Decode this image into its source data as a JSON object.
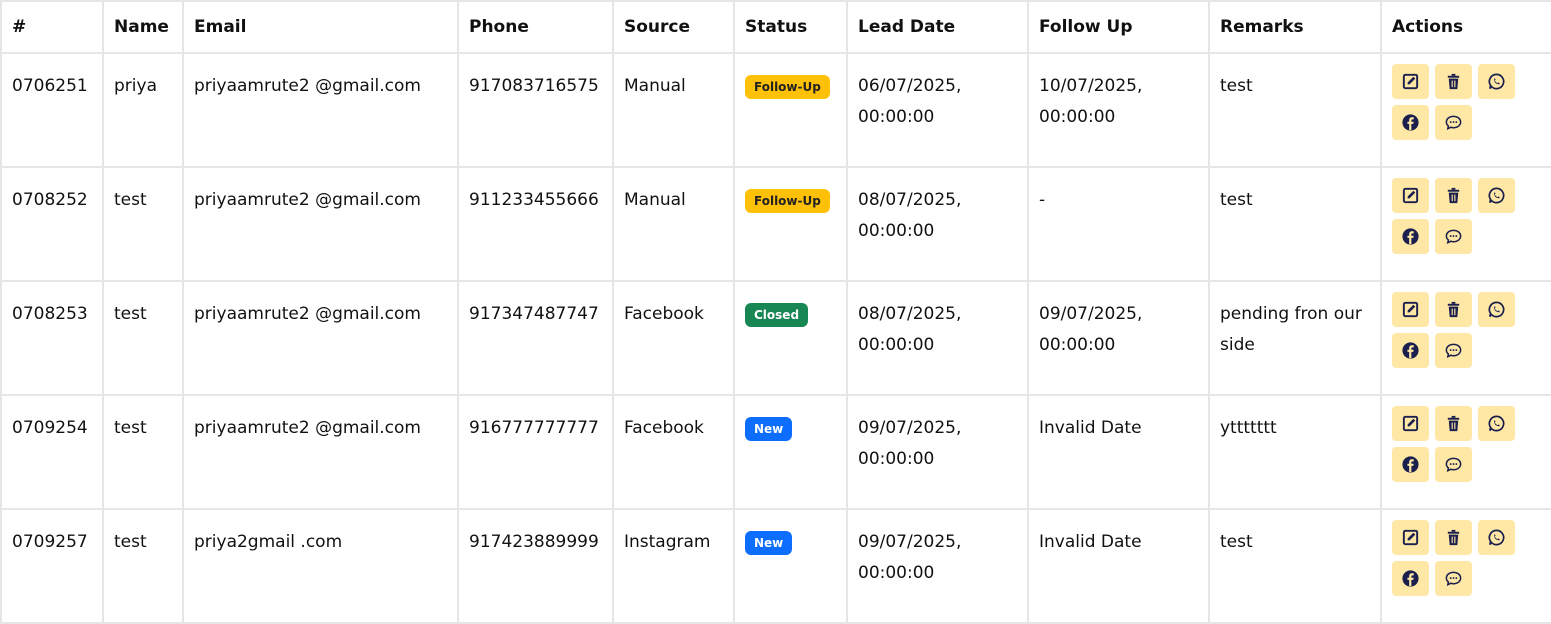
{
  "headers": [
    "#",
    "Name",
    "Email",
    "Phone",
    "Source",
    "Status",
    "Lead Date",
    "Follow Up",
    "Remarks",
    "Actions"
  ],
  "rows": [
    {
      "id": "0706251",
      "name": "priya",
      "email": "priyaamrute2 @gmail.com",
      "phone": "917083716575",
      "source": "Manual",
      "status": "Follow-Up",
      "lead_date": "06/07/2025, 00:00:00",
      "follow_up": "10/07/2025, 00:00:00",
      "remarks": "test"
    },
    {
      "id": "0708252",
      "name": "test",
      "email": "priyaamrute2 @gmail.com",
      "phone": "911233455666",
      "source": "Manual",
      "status": "Follow-Up",
      "lead_date": "08/07/2025, 00:00:00",
      "follow_up": "-",
      "remarks": "test"
    },
    {
      "id": "0708253",
      "name": "test",
      "email": "priyaamrute2 @gmail.com",
      "phone": "917347487747",
      "source": "Facebook",
      "status": "Closed",
      "lead_date": "08/07/2025, 00:00:00",
      "follow_up": "09/07/2025, 00:00:00",
      "remarks": "pending fron our side"
    },
    {
      "id": "0709254",
      "name": "test",
      "email": "priyaamrute2 @gmail.com",
      "phone": "916777777777",
      "source": "Facebook",
      "status": "New",
      "lead_date": "09/07/2025, 00:00:00",
      "follow_up": "Invalid Date",
      "remarks": "yttttttt"
    },
    {
      "id": "0709257",
      "name": "test",
      "email": "priya2gmail .com",
      "phone": "917423889999",
      "source": "Instagram",
      "status": "New",
      "lead_date": "09/07/2025, 00:00:00",
      "follow_up": "Invalid Date",
      "remarks": "test"
    }
  ],
  "status_colors": {
    "Follow-Up": "#ffc107",
    "Closed": "#198754",
    "New": "#0d6efd"
  },
  "action_icons": [
    "edit-icon",
    "delete-icon",
    "whatsapp-icon",
    "facebook-icon",
    "chat-icon"
  ],
  "action_button_color": "#ffe8a6",
  "icon_color": "#1a1f4d"
}
